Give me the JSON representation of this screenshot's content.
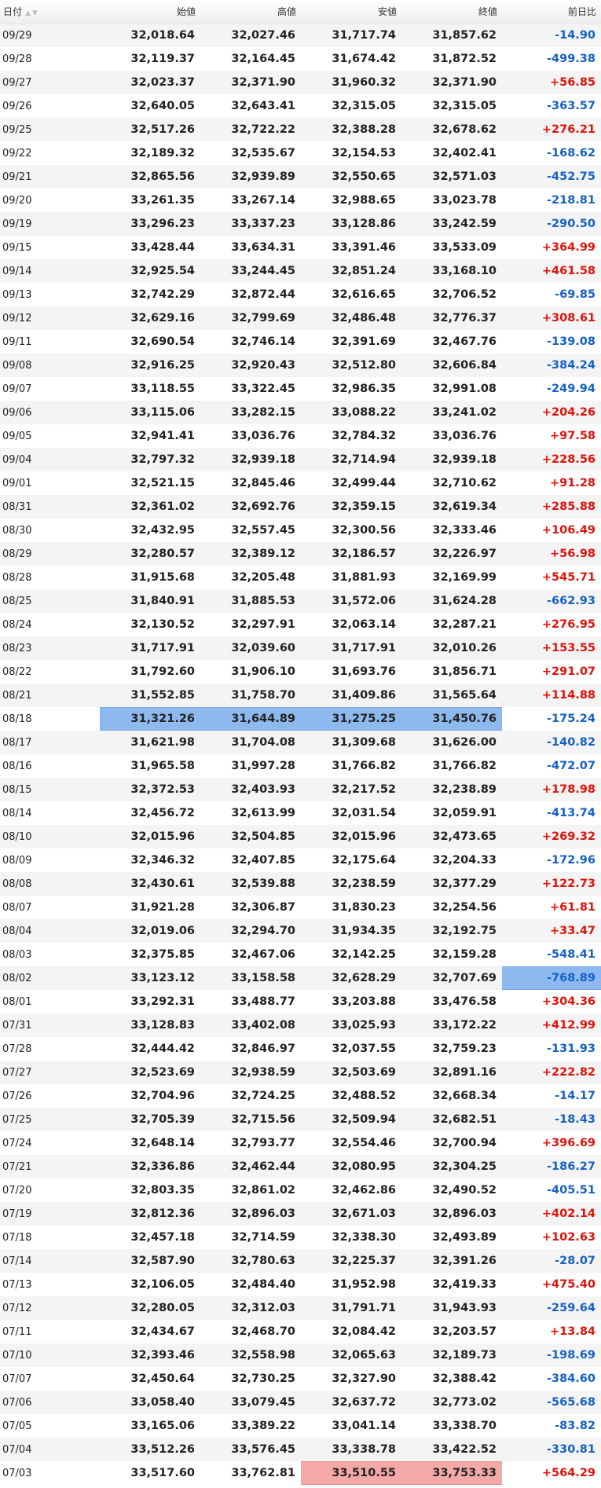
{
  "headers": {
    "date": "日付",
    "open": "始値",
    "high": "高値",
    "low": "安値",
    "close": "終値",
    "change": "前日比"
  },
  "sort_icons": [
    "sort-ascending-icon",
    "sort-descending-icon"
  ],
  "colors": {
    "positive": "#e0120a",
    "negative": "#1560c8",
    "highlight_blue": "#8db9ef",
    "highlight_pink": "#f5a8a8"
  },
  "rows": [
    {
      "date": "09/29",
      "open": "32,018.64",
      "high": "32,027.46",
      "low": "31,717.74",
      "close": "31,857.62",
      "change": "-14.90"
    },
    {
      "date": "09/28",
      "open": "32,119.37",
      "high": "32,164.45",
      "low": "31,674.42",
      "close": "31,872.52",
      "change": "-499.38"
    },
    {
      "date": "09/27",
      "open": "32,023.37",
      "high": "32,371.90",
      "low": "31,960.32",
      "close": "32,371.90",
      "change": "+56.85"
    },
    {
      "date": "09/26",
      "open": "32,640.05",
      "high": "32,643.41",
      "low": "32,315.05",
      "close": "32,315.05",
      "change": "-363.57"
    },
    {
      "date": "09/25",
      "open": "32,517.26",
      "high": "32,722.22",
      "low": "32,388.28",
      "close": "32,678.62",
      "change": "+276.21"
    },
    {
      "date": "09/22",
      "open": "32,189.32",
      "high": "32,535.67",
      "low": "32,154.53",
      "close": "32,402.41",
      "change": "-168.62"
    },
    {
      "date": "09/21",
      "open": "32,865.56",
      "high": "32,939.89",
      "low": "32,550.65",
      "close": "32,571.03",
      "change": "-452.75"
    },
    {
      "date": "09/20",
      "open": "33,261.35",
      "high": "33,267.14",
      "low": "32,988.65",
      "close": "33,023.78",
      "change": "-218.81"
    },
    {
      "date": "09/19",
      "open": "33,296.23",
      "high": "33,337.23",
      "low": "33,128.86",
      "close": "33,242.59",
      "change": "-290.50"
    },
    {
      "date": "09/15",
      "open": "33,428.44",
      "high": "33,634.31",
      "low": "33,391.46",
      "close": "33,533.09",
      "change": "+364.99"
    },
    {
      "date": "09/14",
      "open": "32,925.54",
      "high": "33,244.45",
      "low": "32,851.24",
      "close": "33,168.10",
      "change": "+461.58"
    },
    {
      "date": "09/13",
      "open": "32,742.29",
      "high": "32,872.44",
      "low": "32,616.65",
      "close": "32,706.52",
      "change": "-69.85"
    },
    {
      "date": "09/12",
      "open": "32,629.16",
      "high": "32,799.69",
      "low": "32,486.48",
      "close": "32,776.37",
      "change": "+308.61"
    },
    {
      "date": "09/11",
      "open": "32,690.54",
      "high": "32,746.14",
      "low": "32,391.69",
      "close": "32,467.76",
      "change": "-139.08"
    },
    {
      "date": "09/08",
      "open": "32,916.25",
      "high": "32,920.43",
      "low": "32,512.80",
      "close": "32,606.84",
      "change": "-384.24"
    },
    {
      "date": "09/07",
      "open": "33,118.55",
      "high": "33,322.45",
      "low": "32,986.35",
      "close": "32,991.08",
      "change": "-249.94"
    },
    {
      "date": "09/06",
      "open": "33,115.06",
      "high": "33,282.15",
      "low": "33,088.22",
      "close": "33,241.02",
      "change": "+204.26"
    },
    {
      "date": "09/05",
      "open": "32,941.41",
      "high": "33,036.76",
      "low": "32,784.32",
      "close": "33,036.76",
      "change": "+97.58"
    },
    {
      "date": "09/04",
      "open": "32,797.32",
      "high": "32,939.18",
      "low": "32,714.94",
      "close": "32,939.18",
      "change": "+228.56"
    },
    {
      "date": "09/01",
      "open": "32,521.15",
      "high": "32,845.46",
      "low": "32,499.44",
      "close": "32,710.62",
      "change": "+91.28"
    },
    {
      "date": "08/31",
      "open": "32,361.02",
      "high": "32,692.76",
      "low": "32,359.15",
      "close": "32,619.34",
      "change": "+285.88"
    },
    {
      "date": "08/30",
      "open": "32,432.95",
      "high": "32,557.45",
      "low": "32,300.56",
      "close": "32,333.46",
      "change": "+106.49"
    },
    {
      "date": "08/29",
      "open": "32,280.57",
      "high": "32,389.12",
      "low": "32,186.57",
      "close": "32,226.97",
      "change": "+56.98"
    },
    {
      "date": "08/28",
      "open": "31,915.68",
      "high": "32,205.48",
      "low": "31,881.93",
      "close": "32,169.99",
      "change": "+545.71"
    },
    {
      "date": "08/25",
      "open": "31,840.91",
      "high": "31,885.53",
      "low": "31,572.06",
      "close": "31,624.28",
      "change": "-662.93"
    },
    {
      "date": "08/24",
      "open": "32,130.52",
      "high": "32,297.91",
      "low": "32,063.14",
      "close": "32,287.21",
      "change": "+276.95"
    },
    {
      "date": "08/23",
      "open": "31,717.91",
      "high": "32,039.60",
      "low": "31,717.91",
      "close": "32,010.26",
      "change": "+153.55"
    },
    {
      "date": "08/22",
      "open": "31,792.60",
      "high": "31,906.10",
      "low": "31,693.76",
      "close": "31,856.71",
      "change": "+291.07"
    },
    {
      "date": "08/21",
      "open": "31,552.85",
      "high": "31,758.70",
      "low": "31,409.86",
      "close": "31,565.64",
      "change": "+114.88"
    },
    {
      "date": "08/18",
      "open": "31,321.26",
      "high": "31,644.89",
      "low": "31,275.25",
      "close": "31,450.76",
      "change": "-175.24",
      "hl": {
        "open": "blue",
        "high": "blue",
        "low": "blue",
        "close": "blue"
      }
    },
    {
      "date": "08/17",
      "open": "31,621.98",
      "high": "31,704.08",
      "low": "31,309.68",
      "close": "31,626.00",
      "change": "-140.82"
    },
    {
      "date": "08/16",
      "open": "31,965.58",
      "high": "31,997.28",
      "low": "31,766.82",
      "close": "31,766.82",
      "change": "-472.07"
    },
    {
      "date": "08/15",
      "open": "32,372.53",
      "high": "32,403.93",
      "low": "32,217.52",
      "close": "32,238.89",
      "change": "+178.98"
    },
    {
      "date": "08/14",
      "open": "32,456.72",
      "high": "32,613.99",
      "low": "32,031.54",
      "close": "32,059.91",
      "change": "-413.74"
    },
    {
      "date": "08/10",
      "open": "32,015.96",
      "high": "32,504.85",
      "low": "32,015.96",
      "close": "32,473.65",
      "change": "+269.32"
    },
    {
      "date": "08/09",
      "open": "32,346.32",
      "high": "32,407.85",
      "low": "32,175.64",
      "close": "32,204.33",
      "change": "-172.96"
    },
    {
      "date": "08/08",
      "open": "32,430.61",
      "high": "32,539.88",
      "low": "32,238.59",
      "close": "32,377.29",
      "change": "+122.73"
    },
    {
      "date": "08/07",
      "open": "31,921.28",
      "high": "32,306.87",
      "low": "31,830.23",
      "close": "32,254.56",
      "change": "+61.81"
    },
    {
      "date": "08/04",
      "open": "32,019.06",
      "high": "32,294.70",
      "low": "31,934.35",
      "close": "32,192.75",
      "change": "+33.47"
    },
    {
      "date": "08/03",
      "open": "32,375.85",
      "high": "32,467.06",
      "low": "32,142.25",
      "close": "32,159.28",
      "change": "-548.41"
    },
    {
      "date": "08/02",
      "open": "33,123.12",
      "high": "33,158.58",
      "low": "32,628.29",
      "close": "32,707.69",
      "change": "-768.89",
      "hl": {
        "change": "blue"
      }
    },
    {
      "date": "08/01",
      "open": "33,292.31",
      "high": "33,488.77",
      "low": "33,203.88",
      "close": "33,476.58",
      "change": "+304.36"
    },
    {
      "date": "07/31",
      "open": "33,128.83",
      "high": "33,402.08",
      "low": "33,025.93",
      "close": "33,172.22",
      "change": "+412.99"
    },
    {
      "date": "07/28",
      "open": "32,444.42",
      "high": "32,846.97",
      "low": "32,037.55",
      "close": "32,759.23",
      "change": "-131.93"
    },
    {
      "date": "07/27",
      "open": "32,523.69",
      "high": "32,938.59",
      "low": "32,503.69",
      "close": "32,891.16",
      "change": "+222.82"
    },
    {
      "date": "07/26",
      "open": "32,704.96",
      "high": "32,724.25",
      "low": "32,488.52",
      "close": "32,668.34",
      "change": "-14.17"
    },
    {
      "date": "07/25",
      "open": "32,705.39",
      "high": "32,715.56",
      "low": "32,509.94",
      "close": "32,682.51",
      "change": "-18.43"
    },
    {
      "date": "07/24",
      "open": "32,648.14",
      "high": "32,793.77",
      "low": "32,554.46",
      "close": "32,700.94",
      "change": "+396.69"
    },
    {
      "date": "07/21",
      "open": "32,336.86",
      "high": "32,462.44",
      "low": "32,080.95",
      "close": "32,304.25",
      "change": "-186.27"
    },
    {
      "date": "07/20",
      "open": "32,803.35",
      "high": "32,861.02",
      "low": "32,462.86",
      "close": "32,490.52",
      "change": "-405.51"
    },
    {
      "date": "07/19",
      "open": "32,812.36",
      "high": "32,896.03",
      "low": "32,671.03",
      "close": "32,896.03",
      "change": "+402.14"
    },
    {
      "date": "07/18",
      "open": "32,457.18",
      "high": "32,714.59",
      "low": "32,338.30",
      "close": "32,493.89",
      "change": "+102.63"
    },
    {
      "date": "07/14",
      "open": "32,587.90",
      "high": "32,780.63",
      "low": "32,225.37",
      "close": "32,391.26",
      "change": "-28.07"
    },
    {
      "date": "07/13",
      "open": "32,106.05",
      "high": "32,484.40",
      "low": "31,952.98",
      "close": "32,419.33",
      "change": "+475.40"
    },
    {
      "date": "07/12",
      "open": "32,280.05",
      "high": "32,312.03",
      "low": "31,791.71",
      "close": "31,943.93",
      "change": "-259.64"
    },
    {
      "date": "07/11",
      "open": "32,434.67",
      "high": "32,468.70",
      "low": "32,084.42",
      "close": "32,203.57",
      "change": "+13.84"
    },
    {
      "date": "07/10",
      "open": "32,393.46",
      "high": "32,558.98",
      "low": "32,065.63",
      "close": "32,189.73",
      "change": "-198.69"
    },
    {
      "date": "07/07",
      "open": "32,450.64",
      "high": "32,730.25",
      "low": "32,327.90",
      "close": "32,388.42",
      "change": "-384.60"
    },
    {
      "date": "07/06",
      "open": "33,058.40",
      "high": "33,079.45",
      "low": "32,637.72",
      "close": "32,773.02",
      "change": "-565.68"
    },
    {
      "date": "07/05",
      "open": "33,165.06",
      "high": "33,389.22",
      "low": "33,041.14",
      "close": "33,338.70",
      "change": "-83.82"
    },
    {
      "date": "07/04",
      "open": "33,512.26",
      "high": "33,576.45",
      "low": "33,338.78",
      "close": "33,422.52",
      "change": "-330.81"
    },
    {
      "date": "07/03",
      "open": "33,517.60",
      "high": "33,762.81",
      "low": "33,510.55",
      "close": "33,753.33",
      "change": "+564.29",
      "hl": {
        "low": "pink",
        "close": "pink"
      }
    }
  ]
}
